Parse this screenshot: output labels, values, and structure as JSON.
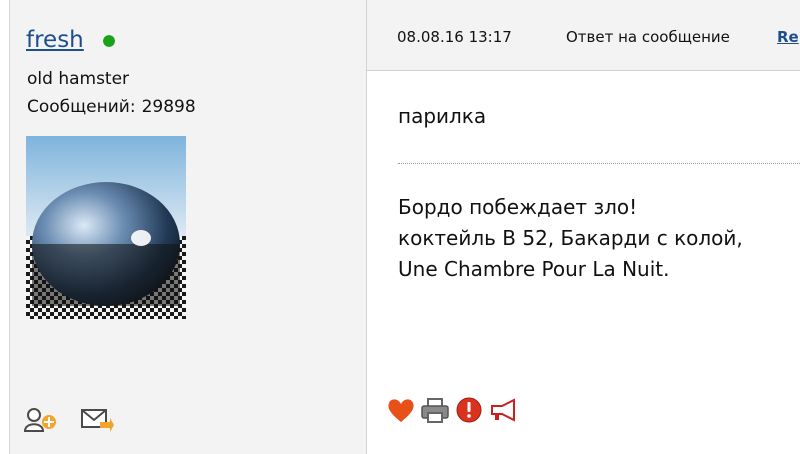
{
  "author": {
    "username": "fresh",
    "online_color": "#1aa31a",
    "title": "old hamster",
    "posts_label": "Сообщений:",
    "posts_count": "29898",
    "actions": [
      {
        "icon": "add-friend-icon"
      },
      {
        "icon": "send-message-icon"
      }
    ]
  },
  "post": {
    "date": "08.08.16 13:17",
    "reply_text": "Ответ на сообщение",
    "reply_link": "Re",
    "title": "парилка",
    "lines": [
      "Бордо побеждает зло!",
      "коктейль В 52, Бакарди с колой,",
      "Une Chambre Pour La Nuit."
    ],
    "actions": [
      {
        "icon": "heart-icon",
        "color": "#e8501a"
      },
      {
        "icon": "print-icon",
        "color": "#666666"
      },
      {
        "icon": "report-icon",
        "color": "#d9331f"
      },
      {
        "icon": "megaphone-icon",
        "color": "#cc2020"
      }
    ]
  },
  "colors": {
    "link": "#1f4e8c",
    "panel_bg": "#f3f3f3"
  }
}
